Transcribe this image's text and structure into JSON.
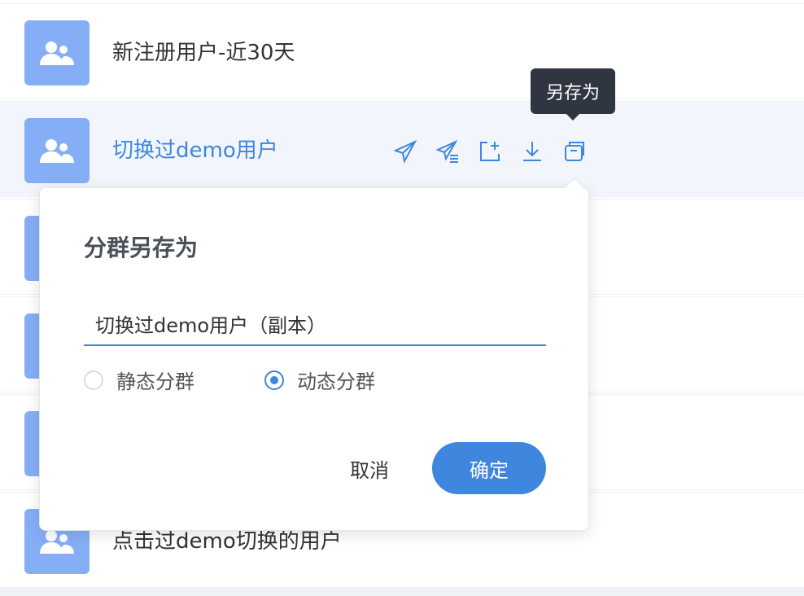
{
  "segments": [
    {
      "label": "新注册用户-近30天"
    },
    {
      "label": "切换过demo用户"
    },
    {
      "label": ""
    },
    {
      "label": ""
    },
    {
      "label": ""
    },
    {
      "label": "点击过demo切换的用户"
    }
  ],
  "tooltip": {
    "text": "另存为"
  },
  "dialog": {
    "title": "分群另存为",
    "name_value": "切换过demo用户（副本）",
    "options": [
      {
        "label": "静态分群",
        "checked": false
      },
      {
        "label": "动态分群",
        "checked": true
      }
    ],
    "cancel_label": "取消",
    "confirm_label": "确定"
  },
  "colors": {
    "accent": "#3e86de",
    "avatar": "#86aef7",
    "tooltip_bg": "#303641",
    "active_row_bg": "#f2f6fc"
  },
  "icons": [
    "users-icon",
    "send-icon",
    "send-list-icon",
    "export-plus-icon",
    "download-icon",
    "copy-icon"
  ]
}
